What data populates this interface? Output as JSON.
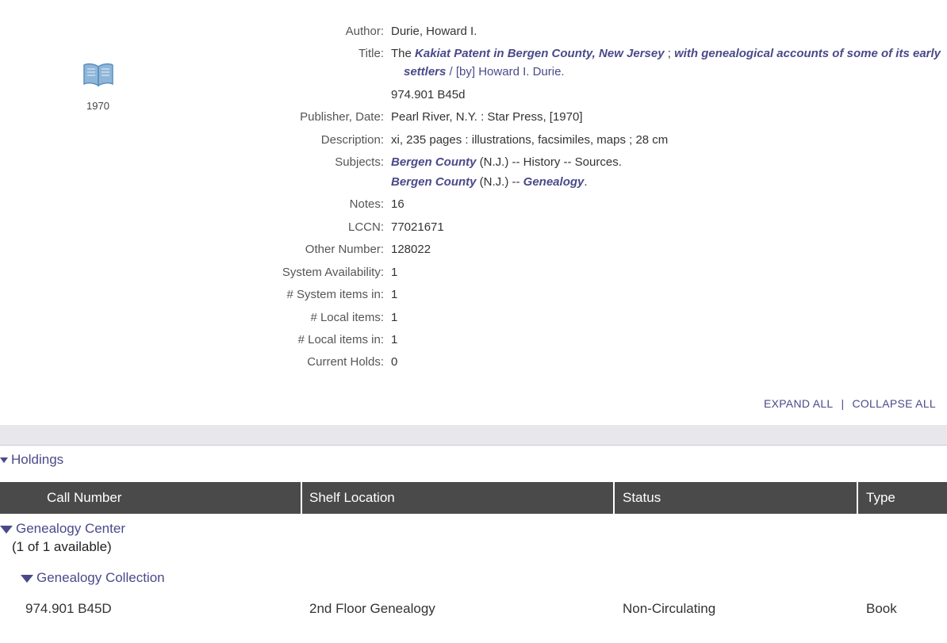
{
  "record": {
    "year": "1970",
    "author": {
      "label": "Author:",
      "value": "Durie, Howard I."
    },
    "title": {
      "label": "Title:",
      "prefix": "The ",
      "bold1": "Kakiat Patent in Bergen County",
      "comma": ", ",
      "bold2": "New Jersey",
      "mid": " ; ",
      "bold3": "with genealogical accounts of some of its early",
      "bold4": "settlers",
      "suffix": " / [by] Howard I. Durie."
    },
    "call_number": "974.901 B45d",
    "publisher": {
      "label": "Publisher, Date:",
      "value": "Pearl River, N.Y. : Star Press, [1970]"
    },
    "description": {
      "label": "Description:",
      "value": "xi, 235 pages : illustrations, facsimiles, maps ; 28 cm"
    },
    "subjects": {
      "label": "Subjects:",
      "s1_bold": "Bergen County",
      "s1_rest": " (N.J.) -- History -- Sources.",
      "s2_bold": "Bergen County",
      "s2_mid": " (N.J.) -- ",
      "s2_bold2": "Genealogy",
      "s2_end": "."
    },
    "notes": {
      "label": "Notes:",
      "value": "16"
    },
    "lccn": {
      "label": "LCCN:",
      "value": "77021671"
    },
    "other_number": {
      "label": "Other Number:",
      "value": "128022"
    },
    "system_availability": {
      "label": "System Availability:",
      "value": "1"
    },
    "system_items_in": {
      "label": "# System items in:",
      "value": "1"
    },
    "local_items": {
      "label": "# Local items:",
      "value": "1"
    },
    "local_items_in": {
      "label": "# Local items in:",
      "value": "1"
    },
    "current_holds": {
      "label": "Current Holds:",
      "value": "0"
    }
  },
  "controls": {
    "expand_all": "EXPAND ALL",
    "separator": "|",
    "collapse_all": "COLLAPSE ALL"
  },
  "holdings": {
    "title": "Holdings",
    "columns": [
      "Call Number",
      "Shelf Location",
      "Status",
      "Type"
    ],
    "org": "Genealogy Center",
    "availability": "(1 of 1 available)",
    "collection": "Genealogy Collection",
    "row": {
      "call_number": "974.901 B45D",
      "shelf_location": "2nd Floor Genealogy",
      "status": "Non-Circulating",
      "type": "Book"
    }
  },
  "colors": {
    "link": "#4a4a8a",
    "header_bg": "#4a4a4a",
    "band": "#e8e8ec",
    "book_icon": "#6a9bc8"
  },
  "icons": {
    "cover": "book-icon",
    "toggle": "triangle-down-icon"
  }
}
